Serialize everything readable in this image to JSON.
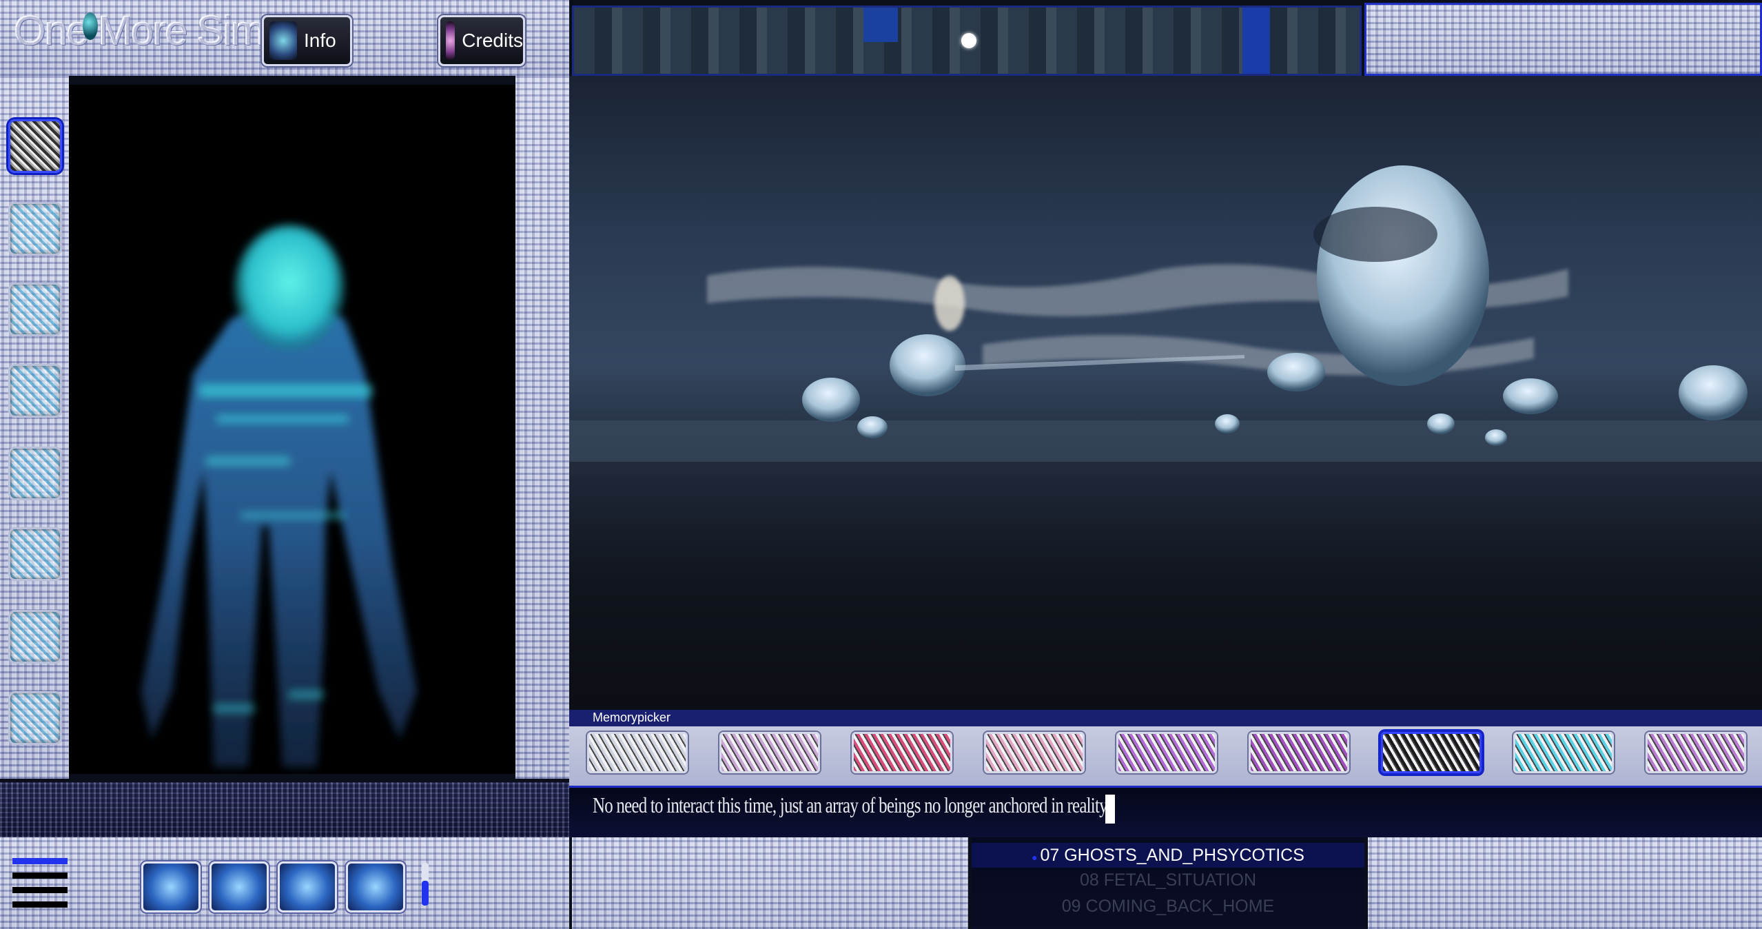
{
  "app": {
    "title": "One More Sim"
  },
  "header": {
    "info_label": "Info",
    "credits_label": "Credits"
  },
  "outfit_slots": [
    "slot-1",
    "slot-2",
    "slot-3",
    "slot-4",
    "slot-5",
    "slot-6",
    "slot-7",
    "slot-8"
  ],
  "selected_slot": 0,
  "memorypicker": {
    "label": "Memorypicker",
    "selected_index": 6,
    "items": [
      {
        "color": "#cfd2df"
      },
      {
        "color": "#c9a6d6"
      },
      {
        "color": "#d84c7a"
      },
      {
        "color": "#e2a6c4"
      },
      {
        "color": "#b26bd6"
      },
      {
        "color": "#a24fc0"
      },
      {
        "color": "#1a1a1a"
      },
      {
        "color": "#5ad2e6"
      },
      {
        "color": "#b97bd2"
      }
    ]
  },
  "dialogue": {
    "text": "No need to interact this time, just an array of beings no longer anchored in reality."
  },
  "tracks": {
    "current": "07 GHOSTS_AND_PHSYCOTICS",
    "next": "08 FETAL_SITUATION",
    "after": "09 COMING_BACK_HOME"
  },
  "volume_level": 0.6,
  "colors": {
    "accent": "#2233ee",
    "selection": "#1424c8",
    "ghost": "#3fc8e0"
  }
}
